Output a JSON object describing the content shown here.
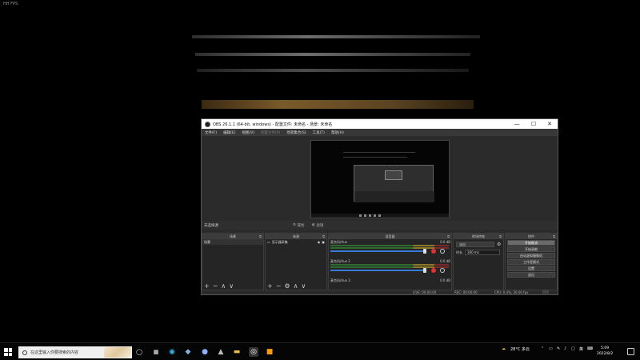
{
  "overlay": {
    "fps_label": "HH FPS"
  },
  "obs": {
    "title": "OBS 26.1.1 (64-bit, windows) - 配置文件: 未命名 - 场景: 未命名",
    "window_controls": {
      "minimize": "—",
      "maximize": "☐",
      "close": "✕"
    },
    "menu": [
      "文件(F)",
      "编辑(E)",
      "视图(V)",
      "配置文件(P)",
      "场景集合(S)",
      "工具(T)",
      "帮助(H)"
    ],
    "scene_bar": {
      "label": "未选择源",
      "properties": "属性",
      "filters": "滤镜"
    },
    "docks": {
      "scenes": {
        "title": "场景",
        "items": [
          "场景"
        ]
      },
      "sources": {
        "title": "来源",
        "items": [
          "显示器采集"
        ]
      },
      "mixer": {
        "title": "混音器",
        "channels": [
          {
            "name": "麦克风/Aux",
            "db": "0.0 dB"
          },
          {
            "name": "麦克风/Aux 2",
            "db": "0.0 dB"
          },
          {
            "name": "麦克风/Aux 3",
            "db": "0.0 dB"
          }
        ]
      },
      "transitions": {
        "title": "转场特效",
        "type": "淡出",
        "duration_label": "时长",
        "duration_value": "300 ms"
      },
      "controls": {
        "title": "控件",
        "buttons": [
          "开始推流",
          "开始录制",
          "启动虚拟摄像机",
          "工作室模式",
          "设置",
          "退出"
        ]
      }
    },
    "toolbar_glyphs": {
      "add": "+",
      "remove": "−",
      "gear": "⚙",
      "up": "∧",
      "down": "∨"
    },
    "status": {
      "live": "LIVE: 00:00:00",
      "rec": "REC: 00:00:00",
      "cpu": "CPU: 0.4%, 30.00 fps"
    }
  },
  "taskbar": {
    "search_placeholder": "在这里输入你要搜索的内容",
    "weather": "28°C 多云",
    "ime": "英",
    "time": "5:09",
    "date": "2022/8/2"
  },
  "icons": [
    "windows-start-icon",
    "search-icon",
    "task-view-icon",
    "edge-icon",
    "steam-icon",
    "app-icon",
    "file-explorer-icon",
    "obs-icon",
    "app-orange-icon",
    "weather-icon",
    "chevron-up-icon",
    "network-icon",
    "volume-icon",
    "keyboard-icon",
    "notification-icon"
  ]
}
